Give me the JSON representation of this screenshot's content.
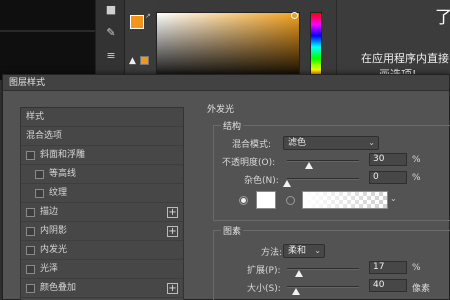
{
  "background": {
    "hint_big": "了",
    "hint_line1": "在应用程序内直接",
    "hint_line2": "画选项!",
    "tools": [
      "brush-icon",
      "wand-icon",
      "sliders-icon"
    ],
    "colors": {
      "foreground": "#f4941b",
      "background": "#ffe9c7"
    }
  },
  "dialog": {
    "title": "图层样式",
    "styles": [
      {
        "label": "样式",
        "checkbox": false,
        "indent": false,
        "plus": false
      },
      {
        "label": "混合选项",
        "checkbox": false,
        "indent": false,
        "plus": false
      },
      {
        "label": "斜面和浮雕",
        "checkbox": true,
        "indent": false,
        "plus": false
      },
      {
        "label": "等高线",
        "checkbox": true,
        "indent": true,
        "plus": false
      },
      {
        "label": "纹理",
        "checkbox": true,
        "indent": true,
        "plus": false
      },
      {
        "label": "描边",
        "checkbox": true,
        "indent": false,
        "plus": true
      },
      {
        "label": "内阴影",
        "checkbox": true,
        "indent": false,
        "plus": true
      },
      {
        "label": "内发光",
        "checkbox": true,
        "indent": false,
        "plus": false
      },
      {
        "label": "光泽",
        "checkbox": true,
        "indent": false,
        "plus": false
      },
      {
        "label": "颜色叠加",
        "checkbox": true,
        "indent": false,
        "plus": true
      }
    ],
    "panel_title": "外发光",
    "structure": {
      "title": "结构",
      "blend_mode_label": "混合模式:",
      "blend_mode_value": "滤色",
      "opacity_label": "不透明度(O):",
      "opacity_value": "30",
      "opacity_fraction": 0.3,
      "opacity_unit": "%",
      "noise_label": "杂色(N):",
      "noise_value": "0",
      "noise_fraction": 0.0,
      "noise_unit": "%",
      "color": "#ffffff"
    },
    "elements": {
      "title": "图素",
      "technique_label": "方法:",
      "technique_value": "柔和",
      "spread_label": "扩展(P):",
      "spread_value": "17",
      "spread_fraction": 0.17,
      "spread_unit": "%",
      "size_label": "大小(S):",
      "size_value": "40",
      "size_unit": "像素"
    }
  }
}
